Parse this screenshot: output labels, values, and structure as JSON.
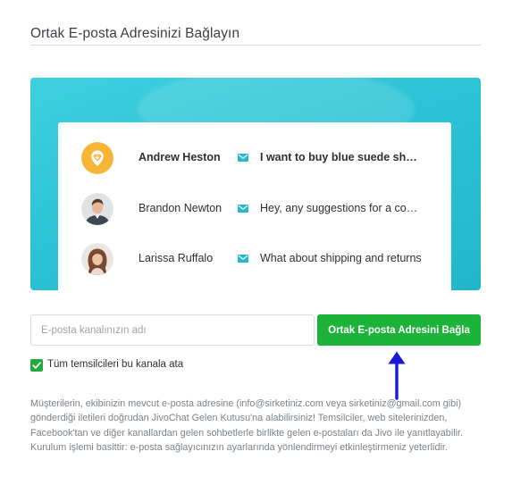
{
  "title": "Ortak E-posta Adresinizi Bağlayın",
  "preview": {
    "rows": [
      {
        "name": "Andrew Heston",
        "message": "I want to buy blue suede shoe…",
        "avatar": "location-pin-icon",
        "unread": true
      },
      {
        "name": "Brandon Newton",
        "message": "Hey, any suggestions for a co…",
        "avatar": "user-photo",
        "unread": false
      },
      {
        "name": "Larissa Ruffalo",
        "message": "What about shipping and returns",
        "avatar": "user-photo",
        "unread": false
      }
    ],
    "icon": "envelope-icon",
    "colors": {
      "accent": "#2cc3d6",
      "mail": "#29b8cf",
      "avatar_pin": "#f7b536"
    }
  },
  "form": {
    "channel_name_placeholder": "E-posta kanalınızın adı",
    "channel_name_value": "",
    "connect_button": "Ortak E-posta Adresini Bağla",
    "assign_all_label": "Tüm temsilcileri bu kanala ata",
    "assign_all_checked": true,
    "button_color": "#1db33b"
  },
  "annotation": {
    "icon": "arrow-up-icon",
    "color": "#1a1ad6"
  },
  "description": "Müşterilerin, ekibinizin mevcut e-posta adresine (info@sirketiniz.com veya sirketiniz@gmail.com gibi) gönderdiği iletileri doğrudan JivoChat Gelen Kutusu'na alabilirsiniz! Temsilciler, web sitelerinizden, Facebook'tan ve diğer kanallardan gelen sohbetlerle birlikte gelen e-postaları da Jivo ile yanıtlayabilir. Kurulum işlemi basittir: e-posta sağlayıcınızın ayarlarında yönlendirmeyi etkinleştirmeniz yeterlidir."
}
